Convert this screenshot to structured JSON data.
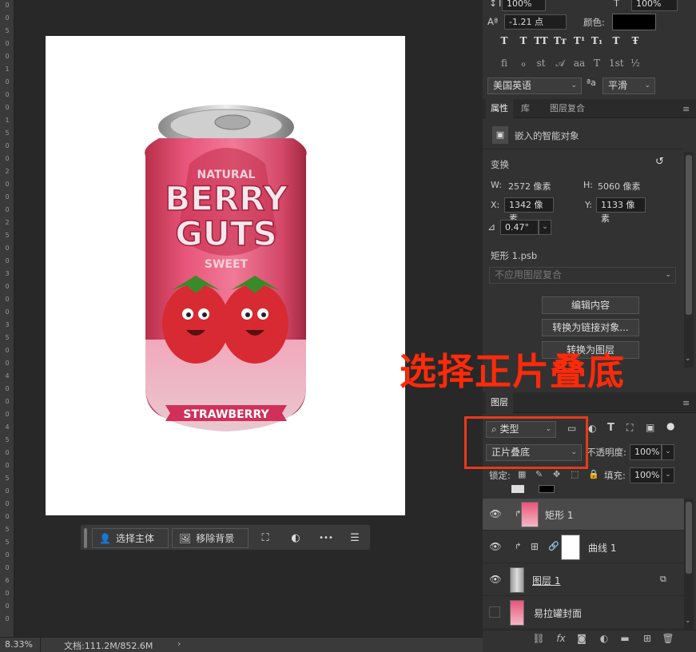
{
  "ruler": {
    "ticks": [
      "0",
      "0",
      "5",
      "0",
      "0",
      "1",
      "0",
      "0",
      "0",
      "1",
      "5",
      "0",
      "0",
      "2",
      "0",
      "0",
      "0",
      "2",
      "5",
      "0",
      "0",
      "3",
      "0",
      "0",
      "0",
      "3",
      "5",
      "0",
      "0",
      "4",
      "0",
      "0",
      "0",
      "4",
      "5",
      "0",
      "0",
      "5",
      "0",
      "0",
      "0",
      "5",
      "5",
      "0",
      "0",
      "6",
      "0",
      "0",
      "0"
    ]
  },
  "context_bar": {
    "select_subject": "选择主体",
    "remove_bg": "移除背景",
    "more": "•••"
  },
  "status": {
    "zoom": "8.33%",
    "doc": "文档:111.2M/852.6M",
    "arrow": "›"
  },
  "character": {
    "vscale": "100%",
    "hscale": "100%",
    "baseline": "-1.21 点",
    "color_label": "颜色:",
    "color_value": "#000000",
    "language": "美国英语",
    "aa_label": "ªa",
    "antialias": "平滑",
    "type_buttons": [
      "T",
      "T",
      "TT",
      "Tт",
      "T¹",
      "T₁",
      "T",
      "Ŧ"
    ],
    "ot_buttons": [
      "fi",
      "ℴ",
      "st",
      "𝒜",
      "aa",
      "T",
      "1st",
      "½"
    ]
  },
  "properties": {
    "tabs": [
      "属性",
      "库",
      "图层复合"
    ],
    "object_type": "嵌入的智能对象",
    "transform_label": "变换",
    "w_label": "W:",
    "w_value": "2572 像素",
    "h_label": "H:",
    "h_value": "5060 像素",
    "x_label": "X:",
    "x_value": "1342 像素",
    "y_label": "Y:",
    "y_value": "1133 像素",
    "angle": "0.47°",
    "file": "矩形 1.psb",
    "comp_placeholder": "不应用图层复合",
    "btn_edit": "编辑内容",
    "btn_link": "转换为链接对象...",
    "btn_layers": "转换为图层"
  },
  "annotation": {
    "text": "选择正片叠底"
  },
  "layers": {
    "title": "图层",
    "filter_type": "类型",
    "blend_mode": "正片叠底",
    "opacity_label": "不透明度:",
    "opacity": "100%",
    "lock_label": "锁定:",
    "fill_label": "填充:",
    "fill": "100%",
    "items": [
      {
        "name": "矩形 1",
        "visible": true,
        "selected": true
      },
      {
        "name": "曲线 1",
        "visible": true,
        "selected": false
      },
      {
        "name": "图层 1",
        "visible": true,
        "selected": false
      },
      {
        "name": "易拉罐封面",
        "visible": false,
        "selected": false
      }
    ]
  },
  "can": {
    "top": "NATURAL",
    "line1": "BERRY",
    "line2": "GUTS",
    "line3": "SWEET",
    "ribbon": "STRAWBERRY"
  },
  "colors": {
    "accent": "#ff2a0a",
    "panel": "#323232",
    "canvas": "#282828"
  }
}
